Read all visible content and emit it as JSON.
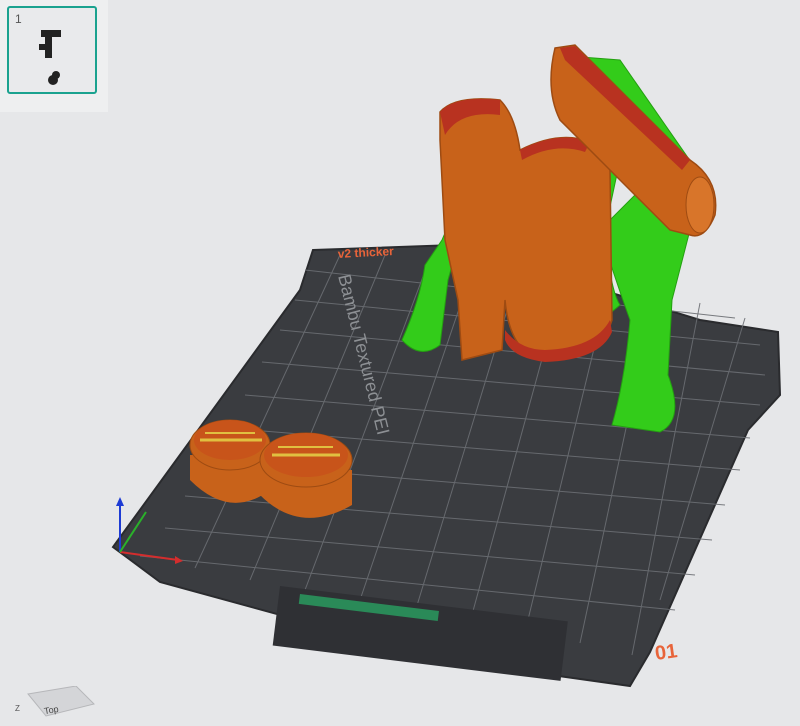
{
  "plate": {
    "index": "1",
    "name_text": "v2 thicker",
    "brand_text": "Bambu Textured PEI",
    "number": "01"
  },
  "view_cube": {
    "face_label": "Top",
    "axis_label": "Z"
  },
  "colors": {
    "background": "#e6e7e9",
    "bed": "#3a3c40",
    "grid": "#6b6e73",
    "accent": "#1aa28f",
    "model": "#c8621a",
    "model_top": "#b83220",
    "support": "#33cc1a",
    "label_orange": "#e8643a"
  }
}
